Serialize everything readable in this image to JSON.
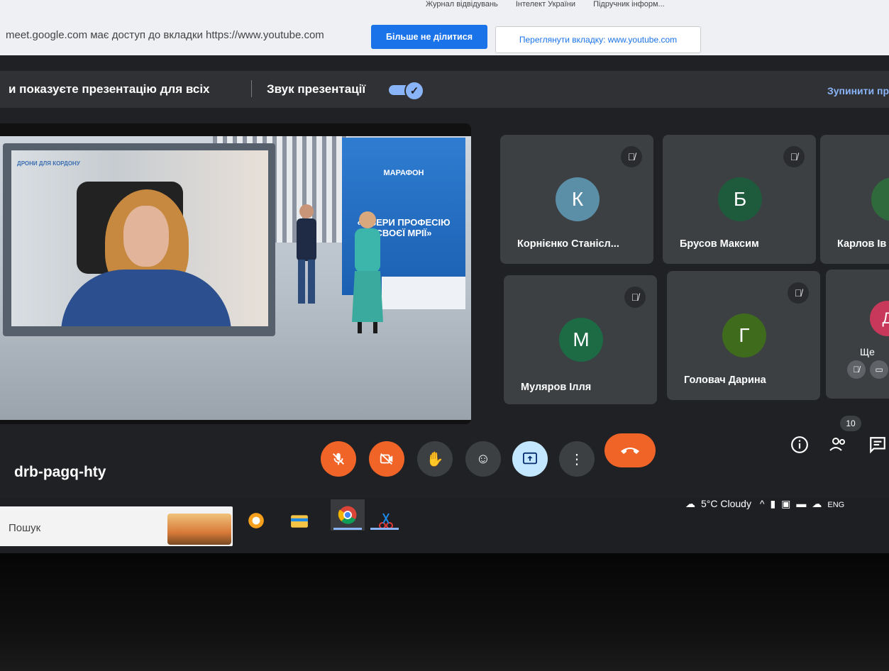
{
  "browser": {
    "bookmarks": [
      "Журнал відвідувань",
      "Інтелект України",
      "Підручник інформ..."
    ],
    "share_message": "meet.google.com має доступ до вкладки https://www.youtube.com",
    "stop_sharing_label": "Більше не ділитися",
    "view_tab_label": "Переглянути вкладку: www.youtube.com"
  },
  "presenting": {
    "banner_text": "и показуєте презентацію для всіх",
    "audio_label": "Звук презентації",
    "audio_enabled": true,
    "stop_label": "Зупинити пр"
  },
  "presentation": {
    "logo_text": "ДРОНИ ДЛЯ КОРДОНУ",
    "panel_title": "МАРАФОН",
    "panel_slogan": "«ОБЕРИ ПРОФЕСІЮ СВОЄЇ МРІЇ»"
  },
  "participants": [
    {
      "initial": "К",
      "name": "Корнієнко Станісл...",
      "color": "#5b8fa8",
      "muted": true
    },
    {
      "initial": "Б",
      "name": "Брусов Максим",
      "color": "#1e5a3c",
      "muted": true
    },
    {
      "initial": "",
      "name": "Карлов Ів",
      "color": "#2f6a3c",
      "muted": false
    },
    {
      "initial": "М",
      "name": "Муляров Ілля",
      "color": "#1c6b45",
      "muted": true
    },
    {
      "initial": "Г",
      "name": "Головач Дарина",
      "color": "#3f6b1c",
      "muted": true
    }
  ],
  "more_tile": {
    "initial": "Д",
    "label": "Ще",
    "color": "#c8385a"
  },
  "meeting": {
    "code": "drb-pagq-hty",
    "people_count": "10"
  },
  "taskbar": {
    "search_placeholder": "Пошук",
    "weather": "5°C Cloudy",
    "language": "ENG"
  }
}
